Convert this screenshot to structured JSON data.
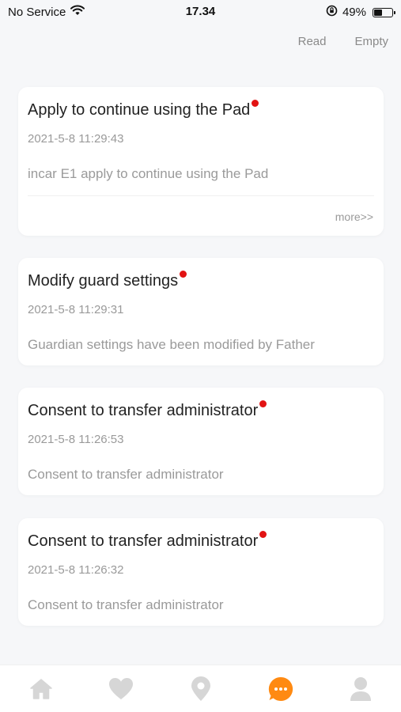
{
  "status_bar": {
    "carrier": "No Service",
    "time": "17.34",
    "battery_percent": "49%",
    "battery_level": 0.49
  },
  "header": {
    "read_label": "Read",
    "empty_label": "Empty"
  },
  "messages": [
    {
      "title": "Apply to continue using the Pad",
      "time": "2021-5-8 11:29:43",
      "body": "incar E1 apply to continue using the Pad",
      "more": "more>>",
      "unread": true
    },
    {
      "title": "Modify guard settings",
      "time": "2021-5-8 11:29:31",
      "body": "Guardian settings have been modified by Father",
      "unread": true
    },
    {
      "title": "Consent to transfer administrator",
      "time": "2021-5-8 11:26:53",
      "body": "Consent to transfer administrator",
      "unread": true
    },
    {
      "title": "Consent to transfer administrator",
      "time": "2021-5-8 11:26:32",
      "body": "Consent to transfer administrator",
      "unread": true
    }
  ],
  "tab_bar": {
    "active_tab": "messages",
    "tabs": [
      "home-icon",
      "heart-icon",
      "location-pin-icon",
      "chat-bubble-icon",
      "profile-icon"
    ]
  },
  "colors": {
    "accent": "#ff8a12",
    "unread_dot": "#e21313",
    "inactive_tab": "#d6d6d6",
    "background": "#f6f7f9",
    "card": "#ffffff"
  }
}
